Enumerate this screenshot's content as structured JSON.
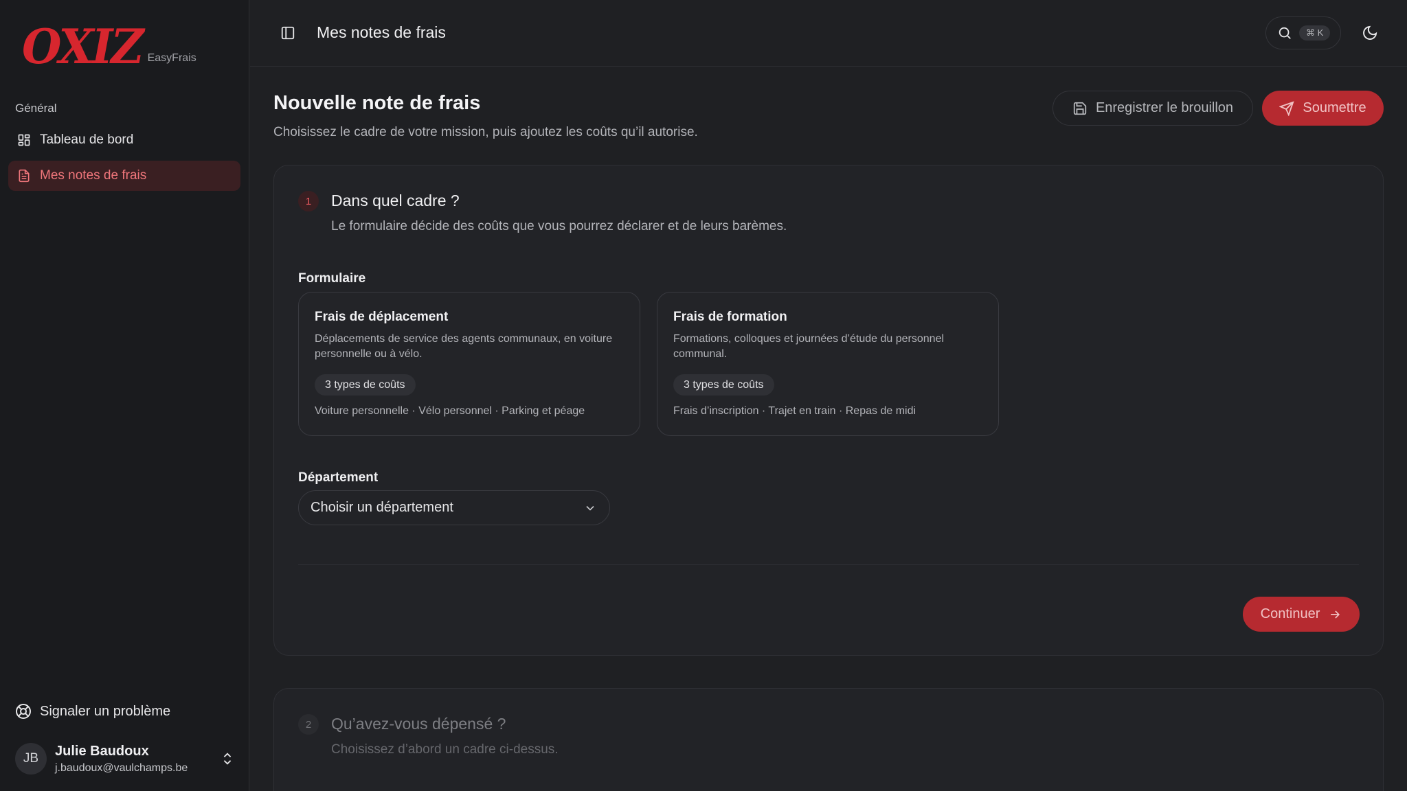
{
  "brand": {
    "logo_text": "OXIZ",
    "product": "EasyFrais",
    "accent": "#d7262e"
  },
  "sidebar": {
    "group_label": "Général",
    "items": [
      {
        "label": "Tableau de bord",
        "icon": "dashboard-icon",
        "active": false
      },
      {
        "label": "Mes notes de frais",
        "icon": "document-icon",
        "active": true
      }
    ],
    "report_label": "Signaler un problème",
    "user": {
      "initials": "JB",
      "name": "Julie Baudoux",
      "email": "j.baudoux@vaulchamps.be"
    }
  },
  "topbar": {
    "title": "Mes notes de frais",
    "shortcut": "⌘ K"
  },
  "page": {
    "title": "Nouvelle note de frais",
    "subtitle": "Choisissez le cadre de votre mission, puis ajoutez les coûts qu’il autorise.",
    "draft_label": "Enregistrer le brouillon",
    "submit_label": "Soumettre"
  },
  "step1": {
    "number": "1",
    "title": "Dans quel cadre ?",
    "subtitle": "Le formulaire décide des coûts que vous pourrez déclarer et de leurs barèmes.",
    "form_label": "Formulaire",
    "options": [
      {
        "title": "Frais de déplacement",
        "desc": "Déplacements de service des agents communaux, en voiture personnelle ou à vélo.",
        "badge": "3 types de coûts",
        "list": "Voiture personnelle · Vélo personnel · Parking et péage"
      },
      {
        "title": "Frais de formation",
        "desc": "Formations, colloques et journées d’étude du personnel communal.",
        "badge": "3 types de coûts",
        "list": "Frais d’inscription · Trajet en train · Repas de midi"
      }
    ],
    "department_label": "Département",
    "department_placeholder": "Choisir un département",
    "continue_label": "Continuer"
  },
  "step2": {
    "number": "2",
    "title": "Qu’avez-vous dépensé ?",
    "subtitle": "Choisissez d’abord un cadre ci-dessus."
  }
}
